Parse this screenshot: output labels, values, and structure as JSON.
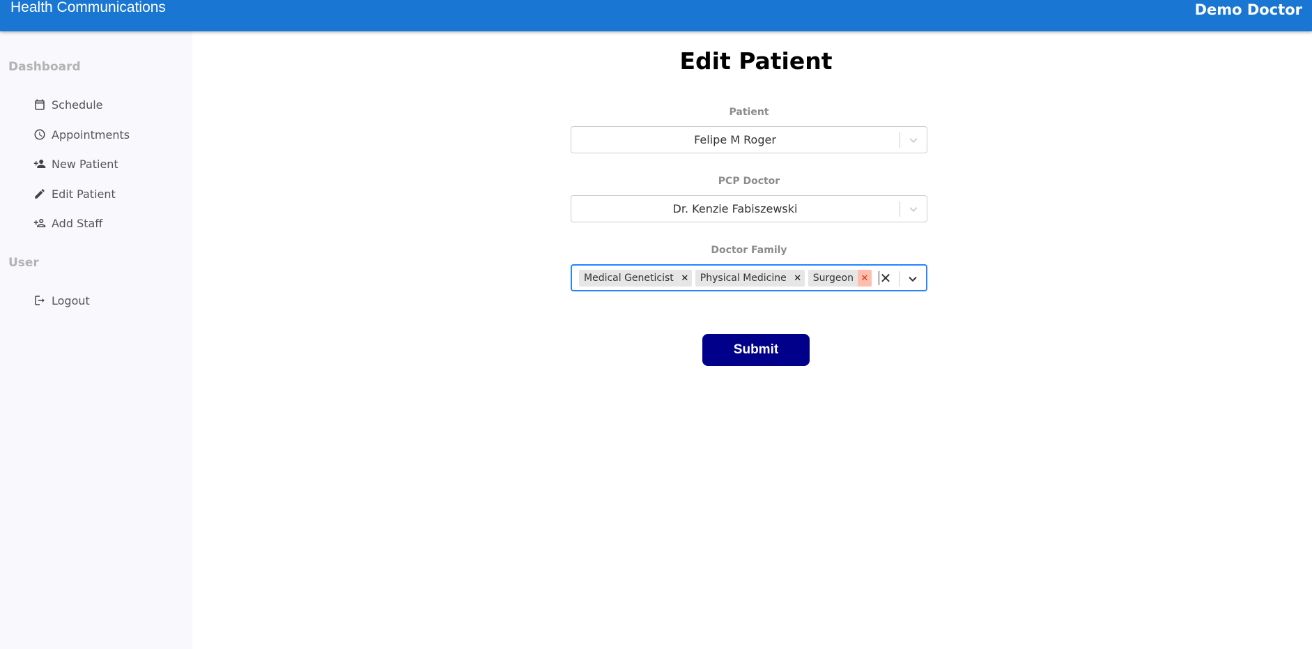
{
  "header": {
    "app_title": "Health Communications",
    "user_name": "Demo Doctor",
    "bg_color": "#1976d2"
  },
  "sidebar": {
    "sections": [
      {
        "title": "Dashboard",
        "items": [
          {
            "label": "Schedule",
            "icon": "calendar-icon"
          },
          {
            "label": "Appointments",
            "icon": "clock-icon"
          },
          {
            "label": "New Patient",
            "icon": "user-plus-icon"
          },
          {
            "label": "Edit Patient",
            "icon": "pencil-icon"
          },
          {
            "label": "Add Staff",
            "icon": "user-add-outline-icon"
          }
        ]
      },
      {
        "title": "User",
        "items": [
          {
            "label": "Logout",
            "icon": "logout-icon"
          }
        ]
      }
    ]
  },
  "main": {
    "title": "Edit Patient",
    "fields": {
      "patient": {
        "label": "Patient",
        "value": "Felipe M Roger"
      },
      "pcp_doctor": {
        "label": "PCP Doctor",
        "value": "Dr. Kenzie Fabiszewski"
      },
      "doctor_family": {
        "label": "Doctor Family",
        "tags": [
          "Medical Geneticist",
          "Physical Medicine",
          "Surgeon"
        ]
      }
    },
    "submit_label": "Submit"
  },
  "colors": {
    "submit_bg": "#00008b",
    "focus_border": "#2684ff",
    "tag_remove_hover": "#ffbdad"
  }
}
